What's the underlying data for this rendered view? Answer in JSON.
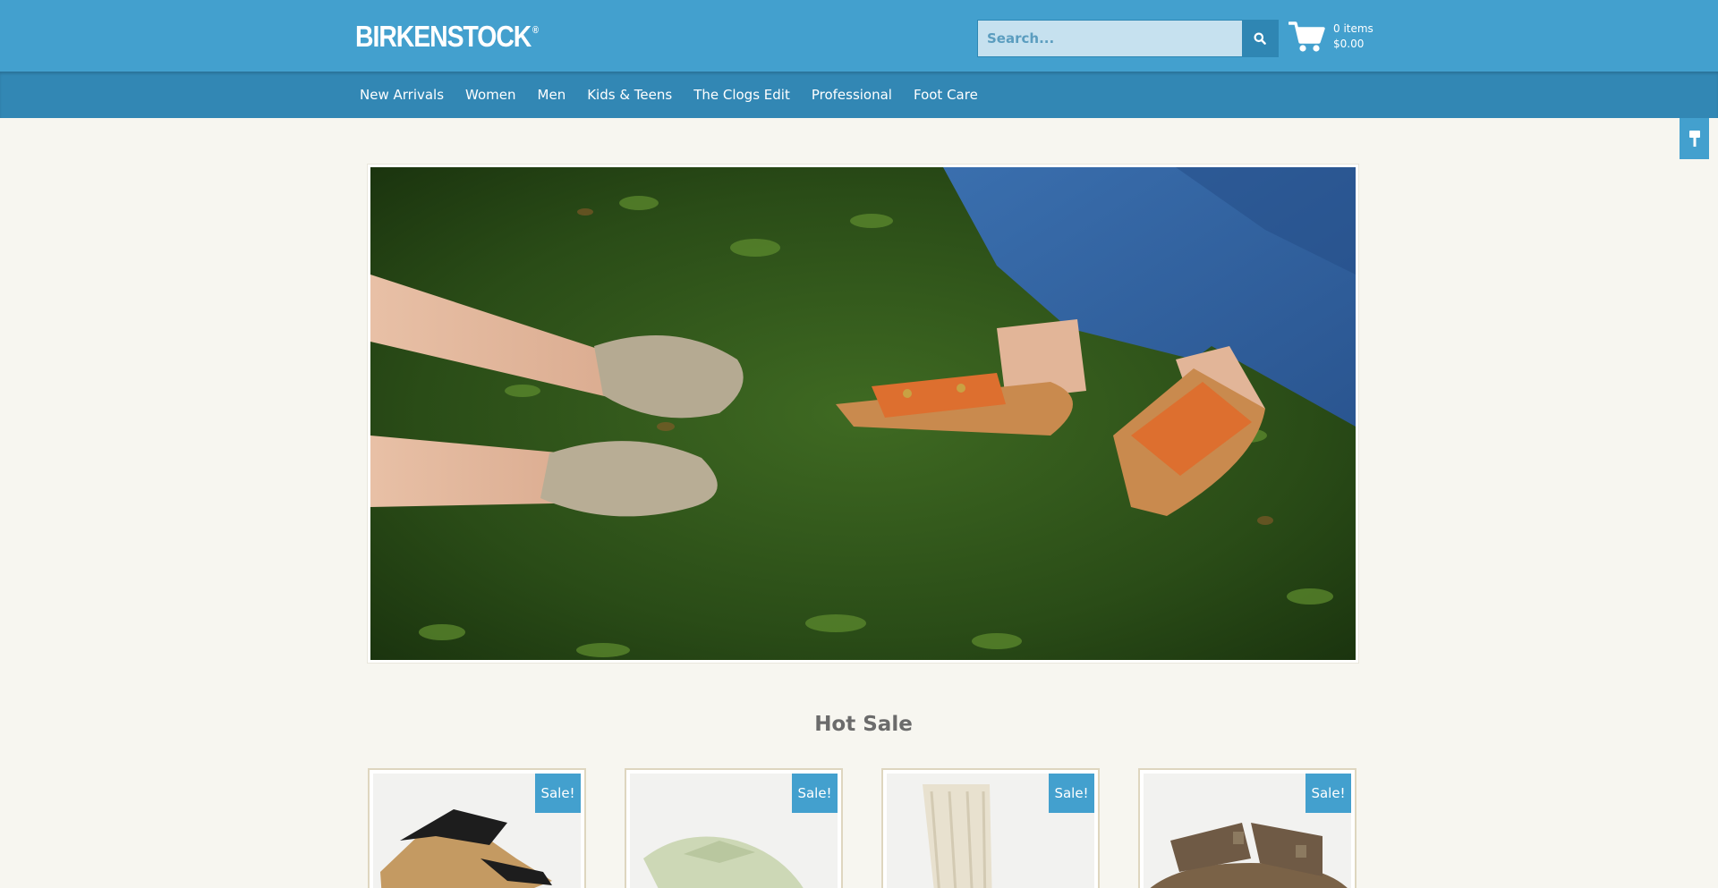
{
  "header": {
    "logo": "BIRKENSTOCK",
    "logo_mark": "®",
    "search": {
      "placeholder": "Search..."
    },
    "cart": {
      "items": "0 items",
      "total": "$0.00"
    }
  },
  "nav": {
    "items": [
      {
        "label": "New Arrivals"
      },
      {
        "label": "Women"
      },
      {
        "label": "Men"
      },
      {
        "label": "Kids & Teens"
      },
      {
        "label": "The Clogs Edit"
      },
      {
        "label": "Professional"
      },
      {
        "label": "Foot Care"
      }
    ]
  },
  "hot_sale": {
    "title": "Hot Sale",
    "products": [
      {
        "badge": "Sale!"
      },
      {
        "badge": "Sale!"
      },
      {
        "badge": "Sale!"
      },
      {
        "badge": "Sale!"
      }
    ]
  },
  "colors": {
    "header_blue": "#43a0ce",
    "nav_blue": "#3287b4",
    "page_background": "#f7f6f0",
    "badge_blue": "#43a0ce"
  },
  "icons": {
    "search": "search-icon",
    "cart": "cart-icon",
    "side_tab": "paint-roller-icon"
  }
}
